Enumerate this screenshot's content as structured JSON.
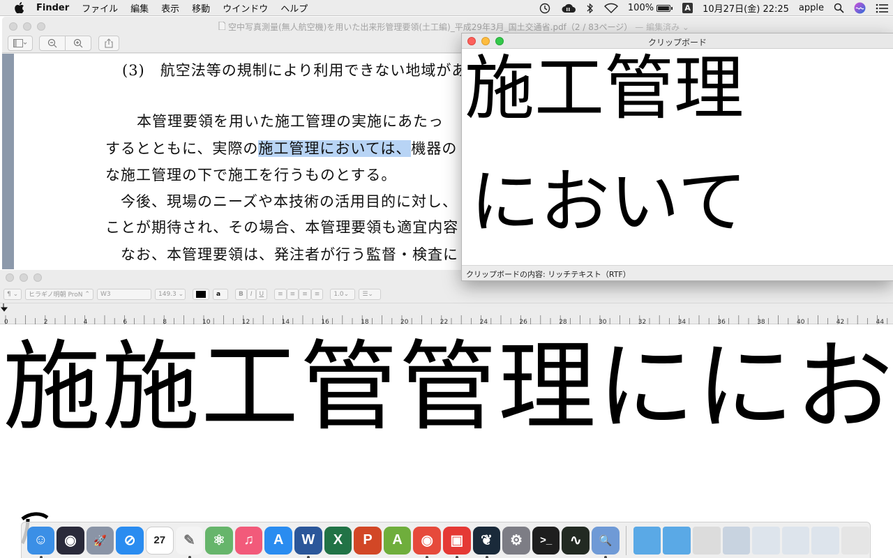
{
  "menubar": {
    "app": "Finder",
    "items": [
      "ファイル",
      "編集",
      "表示",
      "移動",
      "ウインドウ",
      "ヘルプ"
    ],
    "battery": "100%",
    "input_method": "A",
    "clock": "10月27日(金)  22:25",
    "user": "apple",
    "status_icons": [
      "timemachine-icon",
      "creative-cloud-icon",
      "bluetooth-icon",
      "wifi-icon",
      "battery-icon",
      "input-icon",
      "spotlight-icon",
      "siri-icon",
      "notification-icon"
    ]
  },
  "preview": {
    "title": "空中写真測量(無人航空機)を用いた出来形管理要領(土工編)_平成29年3月_国土交通省.pdf（2 / 83ページ）",
    "edited": "— 編集済み ⌄",
    "toolbar": [
      "sidebar-toggle",
      "zoom-out",
      "zoom-in",
      "share"
    ],
    "page_lines": [
      {
        "pre": "(3)　航空法等の規制により利用できない地域があ",
        "hl": "",
        "post": ""
      },
      {
        "pre": "　　本管理要領を用いた施工管理の実施にあたっ",
        "hl": "",
        "post": ""
      },
      {
        "pre": "するとともに、実際の",
        "hl": "施工管理においては、",
        "post": "機器の"
      },
      {
        "pre": "な施工管理の下で施工を行うものとする。",
        "hl": "",
        "post": ""
      },
      {
        "pre": "　今後、現場のニーズや本技術の活用目的に対し、",
        "hl": "",
        "post": ""
      },
      {
        "pre": "ことが期待され、その場合、本管理要領も適宜内容",
        "hl": "",
        "post": ""
      },
      {
        "pre": "　なお、本管理要領は、発注者が行う監督・検査に",
        "hl": "",
        "post": ""
      }
    ]
  },
  "clipboard": {
    "title": "クリップボード",
    "line1": "施工管理",
    "line2": "において",
    "status": "クリップボードの内容: リッチテキスト（RTF）"
  },
  "textedit": {
    "formatbar": {
      "style": "¶",
      "font_family": "ヒラギノ明朝 ProN",
      "font_weight": "W3",
      "font_size": "149.3",
      "bold": "B",
      "italic": "I",
      "underline": "U",
      "spacing": "1.0",
      "list": "☰"
    },
    "ruler_labels": [
      "0",
      "2",
      "4",
      "6",
      "8",
      "10",
      "12",
      "14",
      "16",
      "18",
      "20",
      "22",
      "24",
      "26",
      "28",
      "30",
      "32",
      "34",
      "36",
      "38",
      "40",
      "42",
      "44"
    ],
    "document_text": "施施工管管理ににお"
  },
  "dock": {
    "apps": [
      {
        "name": "finder",
        "color": "#3b8fe6",
        "glyph": "☺",
        "running": true
      },
      {
        "name": "siri",
        "color": "#2a2a3a",
        "glyph": "◉",
        "running": false
      },
      {
        "name": "launchpad",
        "color": "#8a94a6",
        "glyph": "🚀",
        "running": false
      },
      {
        "name": "safari",
        "color": "#2a8cf0",
        "glyph": "⊘",
        "running": false
      },
      {
        "name": "calendar",
        "color": "#ffffff",
        "glyph": "27",
        "running": false
      },
      {
        "name": "textedit",
        "color": "#f4f4f4",
        "glyph": "✎",
        "running": true
      },
      {
        "name": "atom",
        "color": "#66b56b",
        "glyph": "⚛",
        "running": false
      },
      {
        "name": "itunes",
        "color": "#f25a7a",
        "glyph": "♫",
        "running": false
      },
      {
        "name": "app-store",
        "color": "#2a8cf0",
        "glyph": "A",
        "running": false
      },
      {
        "name": "word",
        "color": "#2b579a",
        "glyph": "W",
        "running": true
      },
      {
        "name": "excel",
        "color": "#217346",
        "glyph": "X",
        "running": false
      },
      {
        "name": "powerpoint",
        "color": "#d24726",
        "glyph": "P",
        "running": false
      },
      {
        "name": "android-studio",
        "color": "#6fae3c",
        "glyph": "A",
        "running": false
      },
      {
        "name": "chrome",
        "color": "#e64a3b",
        "glyph": "◉",
        "running": true
      },
      {
        "name": "parallels",
        "color": "#e53935",
        "glyph": "▣",
        "running": true
      },
      {
        "name": "kindle",
        "color": "#1a2a3a",
        "glyph": "❦",
        "running": true
      },
      {
        "name": "system-preferences",
        "color": "#7d7d85",
        "glyph": "⚙",
        "running": false
      },
      {
        "name": "terminal",
        "color": "#1e1e1e",
        "glyph": ">_",
        "running": false
      },
      {
        "name": "activity-monitor",
        "color": "#222a22",
        "glyph": "∿",
        "running": false
      },
      {
        "name": "preview",
        "color": "#6f9ad6",
        "glyph": "🔍",
        "running": true
      }
    ],
    "right_items": [
      {
        "name": "applications-folder",
        "color": "#5aa9e6"
      },
      {
        "name": "downloads-folder",
        "color": "#5aa9e6"
      },
      {
        "name": "document-stack",
        "color": "#dcdcdc"
      },
      {
        "name": "screenshot-stack",
        "color": "#c8d3e0"
      },
      {
        "name": "window-stack-1",
        "color": "#dde4ec"
      },
      {
        "name": "window-stack-2",
        "color": "#dde4ec"
      },
      {
        "name": "window-stack-3",
        "color": "#dde4ec"
      },
      {
        "name": "trash",
        "color": "#e5e5e5"
      }
    ]
  }
}
